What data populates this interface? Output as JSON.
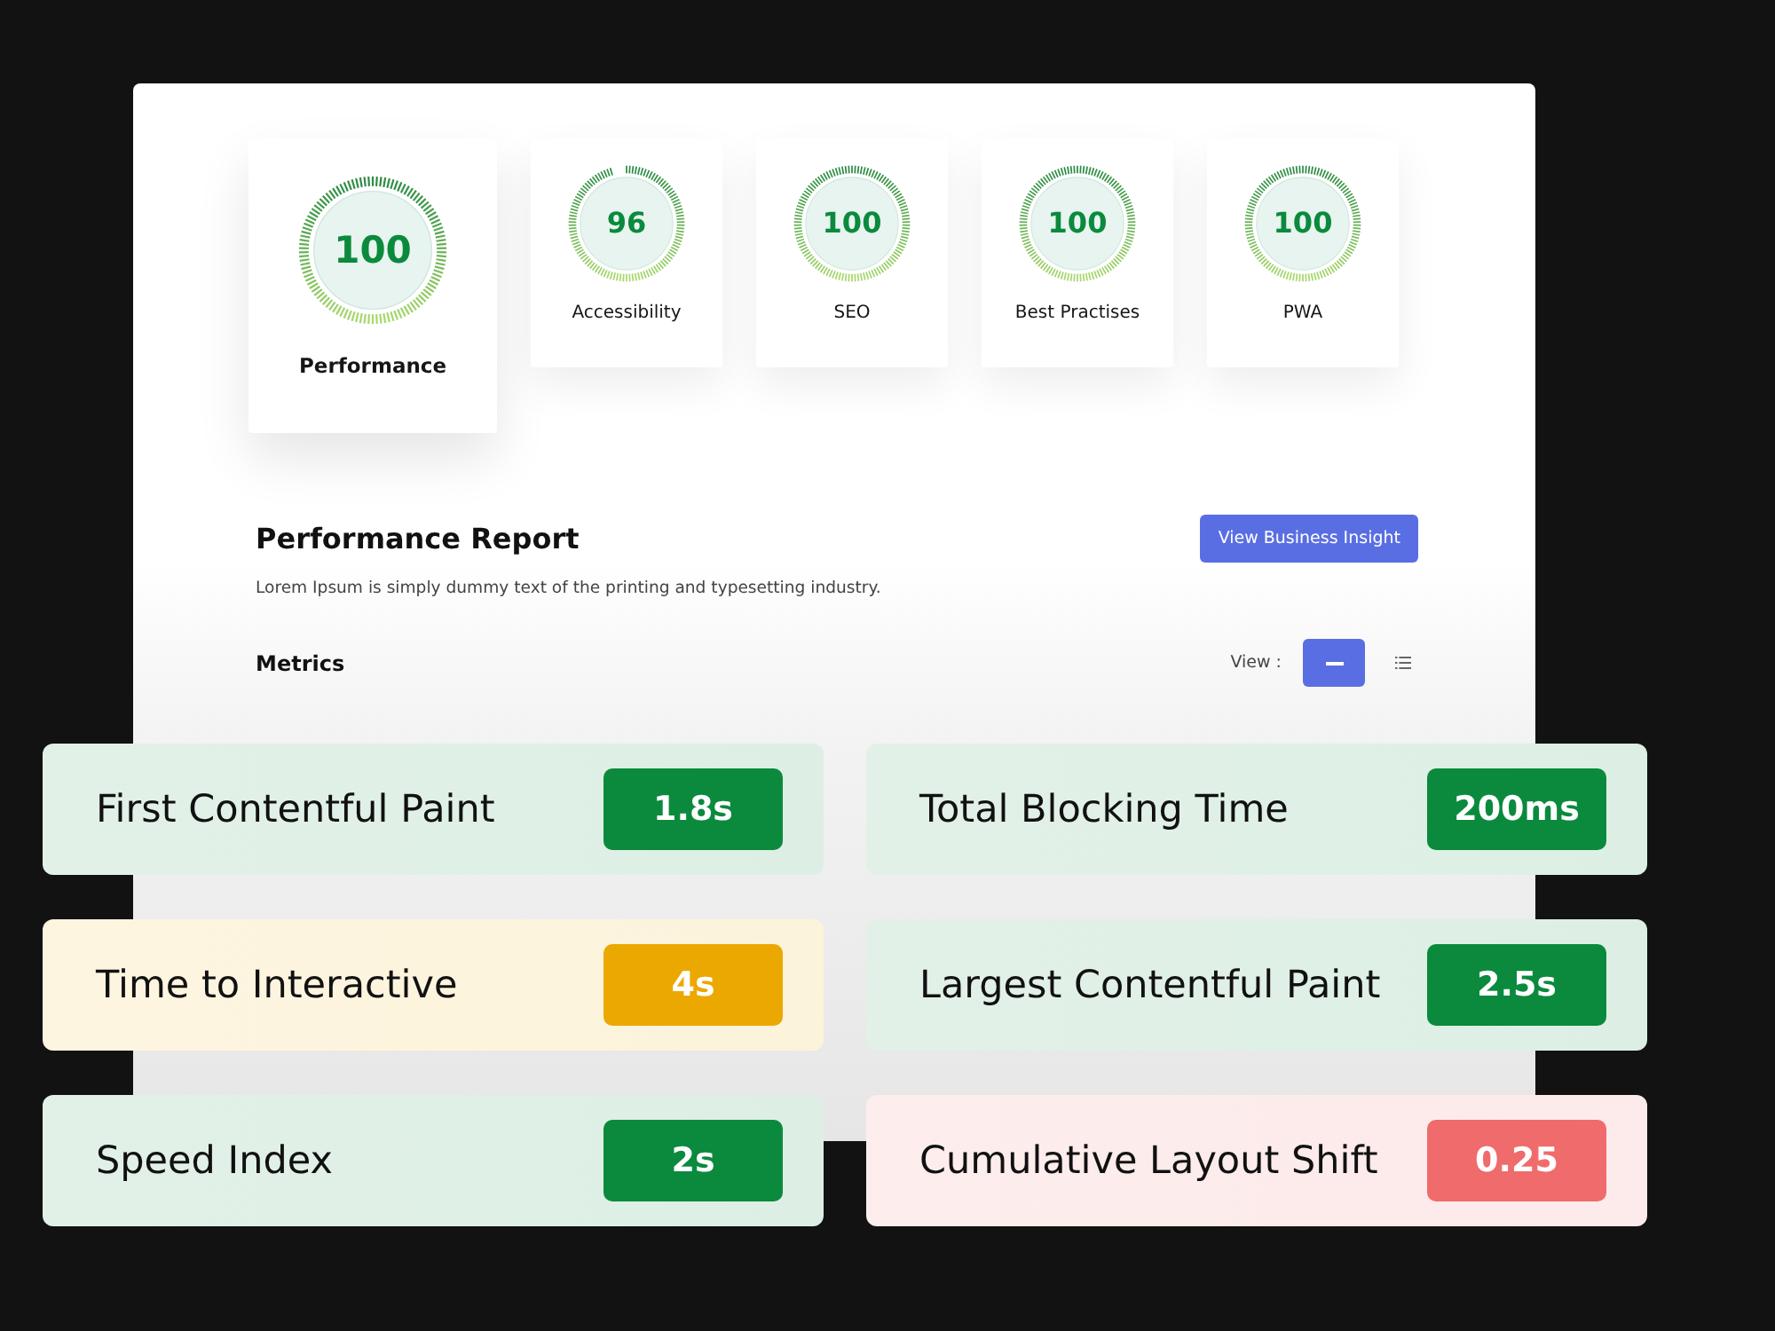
{
  "scores": [
    {
      "kind": "primary",
      "value": "100",
      "label": "Performance",
      "level": 1
    },
    {
      "kind": "secondary",
      "value": "96",
      "label": "Accessibility",
      "level": 0.96
    },
    {
      "kind": "secondary",
      "value": "100",
      "label": "SEO",
      "level": 1
    },
    {
      "kind": "secondary",
      "value": "100",
      "label": "Best Practises",
      "level": 1
    },
    {
      "kind": "secondary",
      "value": "100",
      "label": "PWA",
      "level": 1
    }
  ],
  "report": {
    "title": "Performance Report",
    "description": "Lorem Ipsum is simply dummy text of the printing and typesetting industry.",
    "button": "View Business Insight"
  },
  "metrics_header": {
    "title": "Metrics",
    "view_label": "View :",
    "view_options": [
      {
        "kind": "dash",
        "selected": true
      },
      {
        "kind": "list",
        "selected": false
      }
    ]
  },
  "metrics": [
    {
      "name": "First Contentful Paint",
      "value": "1.8s",
      "color": "#0b8a3d"
    },
    {
      "name": "Total Blocking Time",
      "value": "200ms",
      "color": "#0b8a3d"
    },
    {
      "name": "Time to Interactive",
      "value": "4s",
      "color": "#eba800"
    },
    {
      "name": "Largest Contentful Paint",
      "value": "2.5s",
      "color": "#0b8a3d"
    },
    {
      "name": "Speed Index",
      "value": "2s",
      "color": "#0b8a3d"
    },
    {
      "name": "Cumulative Layout Shift",
      "value": "0.25",
      "color": "#f06b6b"
    }
  ]
}
